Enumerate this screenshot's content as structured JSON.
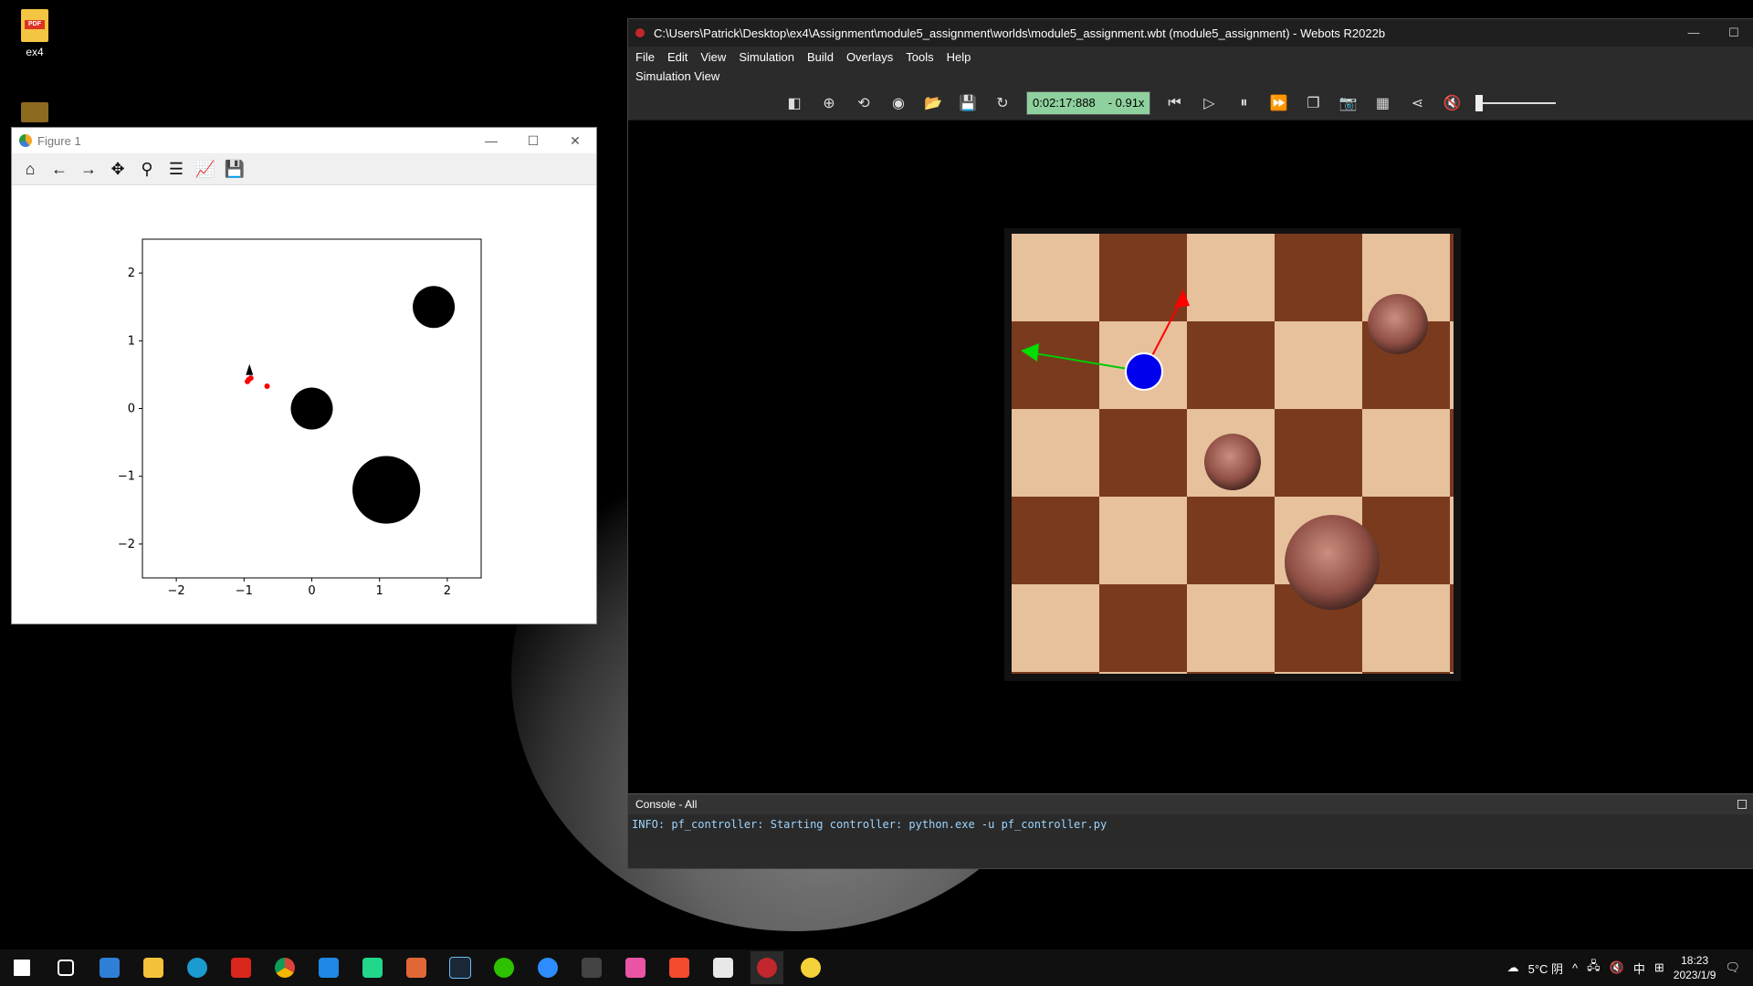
{
  "desktop": {
    "icons": [
      {
        "label": "ex4",
        "icon": "pdf-file-icon"
      },
      {
        "label": "",
        "icon": "folder-icon"
      }
    ]
  },
  "matplotlib": {
    "title": "Figure 1",
    "toolbar": [
      "home-icon",
      "back-icon",
      "forward-icon",
      "pan-icon",
      "zoom-icon",
      "configure-subplots-icon",
      "edit-axis-icon",
      "save-icon"
    ],
    "window_controls": [
      "—",
      "☐",
      "✕"
    ]
  },
  "chart_data": {
    "type": "scatter",
    "title": "",
    "xlabel": "",
    "ylabel": "",
    "xlim": [
      -2.5,
      2.5
    ],
    "ylim": [
      -2.5,
      2.5
    ],
    "xticks": [
      "−2",
      "−1",
      "0",
      "1",
      "2"
    ],
    "yticks": [
      "2",
      "1",
      "0",
      "−1",
      "−2"
    ],
    "obstacles": [
      {
        "x": 1.8,
        "y": 1.5,
        "r": 0.31
      },
      {
        "x": 0.0,
        "y": 0.0,
        "r": 0.31
      },
      {
        "x": 1.1,
        "y": -1.2,
        "r": 0.5
      }
    ],
    "particles": [
      {
        "x": -0.93,
        "y": 0.43,
        "color": "#ff0000"
      },
      {
        "x": -0.95,
        "y": 0.4,
        "color": "#ff0000"
      },
      {
        "x": -0.9,
        "y": 0.45,
        "color": "#ff0000"
      },
      {
        "x": -0.66,
        "y": 0.33,
        "color": "#ff0000"
      }
    ],
    "robot_pose": {
      "x": -0.92,
      "y": 0.55,
      "color": "#000000"
    }
  },
  "webots": {
    "title": "C:\\Users\\Patrick\\Desktop\\ex4\\Assignment\\module5_assignment\\worlds\\module5_assignment.wbt (module5_assignment) - Webots R2022b",
    "menu": [
      "File",
      "Edit",
      "View",
      "Simulation",
      "Build",
      "Overlays",
      "Tools",
      "Help"
    ],
    "subtitle": "Simulation View",
    "time": "0:02:17:888",
    "speed": "-  0.91x",
    "toolbar_icons": [
      "toggle-scene-tree-icon",
      "add-node-icon",
      "reset-view-icon",
      "viewpoint-icon",
      "open-world-icon",
      "save-world-icon",
      "reload-world-icon",
      "step-back-icon",
      "run-icon",
      "pause-icon",
      "fast-forward-icon",
      "view-icon",
      "screenshot-icon",
      "movie-icon",
      "share-icon",
      "mute-icon"
    ],
    "volume": 0.0,
    "console_title": "Console - All",
    "console_line": "INFO: pf_controller: Starting controller: python.exe -u pf_controller.py"
  },
  "taskbar": {
    "apps": [
      "start-icon",
      "task-view-icon",
      "mail-icon",
      "file-explorer-icon",
      "edge-icon",
      "acrobat-icon",
      "chrome-icon",
      "vscode-icon",
      "pycharm-icon",
      "matlab-icon",
      "steam-icon",
      "wechat-icon",
      "zoom-icon",
      "git-icon",
      "app-icon",
      "xmind-icon",
      "office-icon",
      "webots-icon",
      "python-icon"
    ],
    "weather": "5°C 阴",
    "ime": "中",
    "time": "18:23",
    "date": "2023/1/9"
  },
  "colors": {
    "accent_time": "#8fd19e",
    "console_text": "#9ed6ff"
  }
}
